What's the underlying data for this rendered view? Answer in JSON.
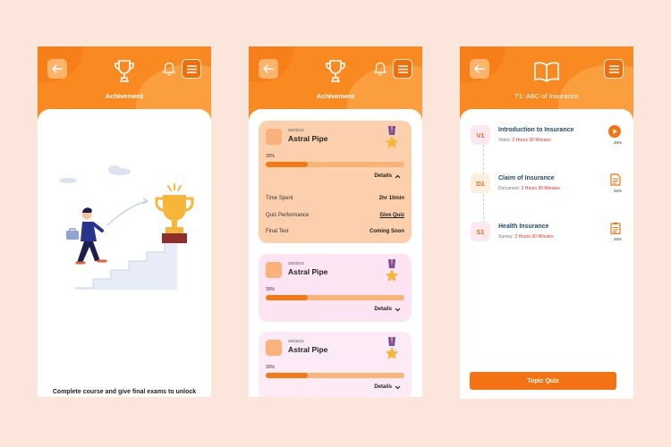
{
  "colors": {
    "background": "#fce6dc",
    "accent": "#f98a22",
    "accent_dark": "#f26e09"
  },
  "screen1": {
    "title": "Achivement",
    "back_icon": "arrow-left-icon",
    "header_icon": "trophy-icon",
    "bell_icon": "bell-icon",
    "menu_icon": "hamburger-icon",
    "empty_message": "Complete course and give final exams to unlock you achivement space"
  },
  "screen2": {
    "title": "Achivement",
    "cards": [
      {
        "date": "20/03/23",
        "name": "Astral Pipe",
        "progress_label": "30%",
        "progress": 0.3,
        "details_label": "Details",
        "expanded": true,
        "bg": "#fcd0ad",
        "rows": [
          {
            "label": "Time Spent",
            "value": "2hr 10min"
          },
          {
            "label": "Quiz Performance",
            "value": "Give Quiz"
          },
          {
            "label": "Final Test",
            "value": "Coming Soon"
          }
        ]
      },
      {
        "date": "20/03/23",
        "name": "Astral Pipe",
        "progress_label": "30%",
        "progress": 0.3,
        "details_label": "Details",
        "expanded": false,
        "bg": "#fde4f3"
      },
      {
        "date": "20/03/23",
        "name": "Astral Pipe",
        "progress_label": "30%",
        "progress": 0.3,
        "details_label": "Details",
        "expanded": false,
        "bg": "#fde8f6"
      }
    ]
  },
  "screen3": {
    "title": "T1: ABC of Insurance",
    "header_icon": "book-icon",
    "items": [
      {
        "badge": "V1",
        "title": "Introduction to Insurance",
        "type": "Video:",
        "duration": "2 Hours 30 Minutes",
        "pct": "25%",
        "icon": "play-icon"
      },
      {
        "badge": "D1",
        "title": "Claim of Insurance",
        "type": "Document:",
        "duration": "2 Hours 30 Minutes",
        "pct": "25%",
        "icon": "document-icon"
      },
      {
        "badge": "S1",
        "title": "Health Insurance",
        "type": "Survey:",
        "duration": "2 Hours 30 Minutes",
        "pct": "25%",
        "icon": "clipboard-icon"
      }
    ],
    "quiz_button": "Topic Quiz"
  }
}
